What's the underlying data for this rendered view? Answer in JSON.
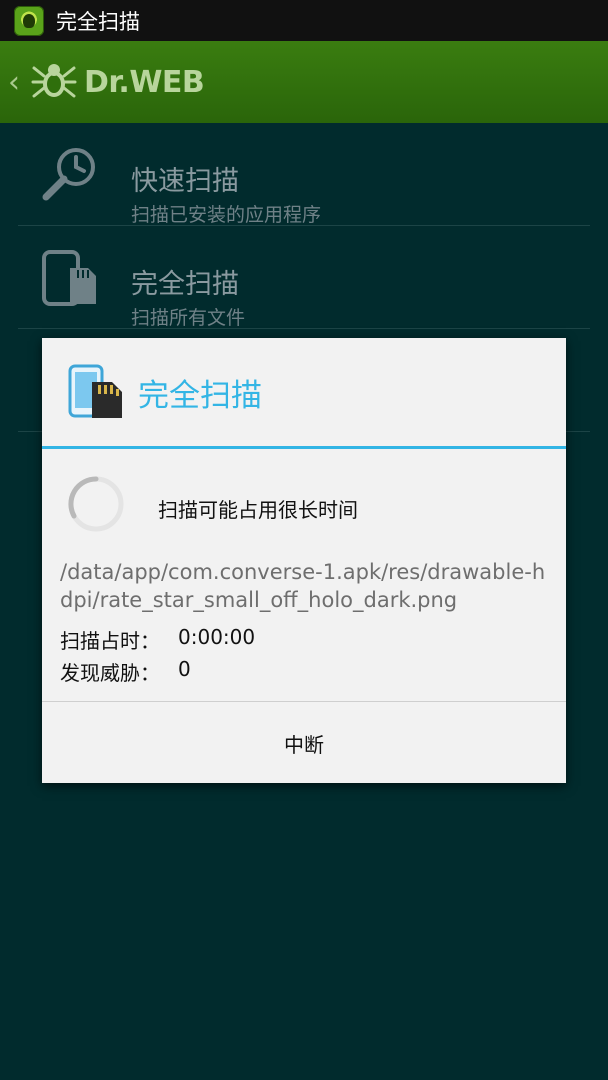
{
  "status_bar": {
    "title": "完全扫描"
  },
  "action_bar": {
    "brand": "Dr.WEB",
    "back_icon": "chevron-left-icon"
  },
  "menu": {
    "items": [
      {
        "label": "快速扫描",
        "sublabel": "扫描已安装的应用程序",
        "icon": "magnifier-clock-icon"
      },
      {
        "label": "完全扫描",
        "sublabel": "扫描所有文件",
        "icon": "phone-sdcard-icon"
      }
    ]
  },
  "dialog": {
    "title": "完全扫描",
    "message": "扫描可能占用很长时间",
    "path": "/data/app/com.converse-1.apk/res/drawable-hdpi/rate_star_small_off_holo_dark.png",
    "stats": [
      {
        "label": "扫描占时：",
        "value": "0:00:00"
      },
      {
        "label": "发现威胁：",
        "value": "0"
      }
    ],
    "button": "中断"
  },
  "colors": {
    "accent": "#33b5e5",
    "actionbar": "#2f6f0c",
    "background": "#012b2d"
  }
}
